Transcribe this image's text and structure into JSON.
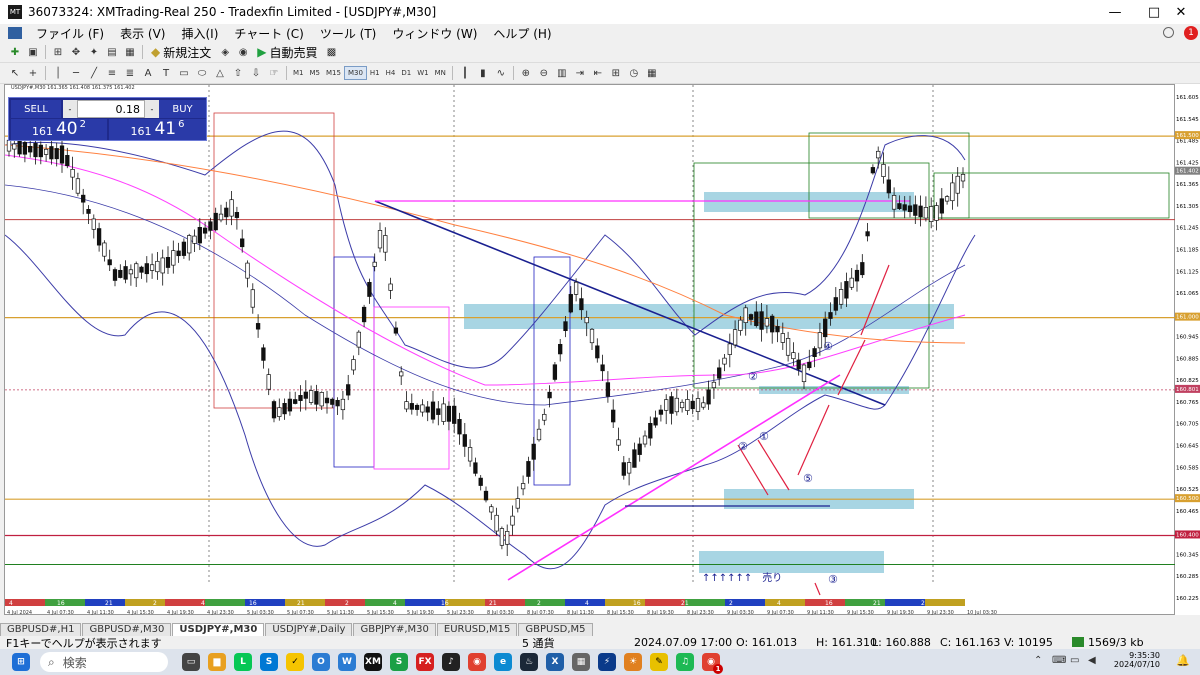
{
  "window": {
    "title": "36073324: XMTrading-Real 250 - Tradexfin Limited - [USDJPY#,M30]",
    "app_icon": "MT",
    "minimize": "—",
    "maximize": "□",
    "close": "✕"
  },
  "menu": [
    "ファイル (F)",
    "表示 (V)",
    "挿入(I)",
    "チャート (C)",
    "ツール (T)",
    "ウィンドウ (W)",
    "ヘルプ (H)"
  ],
  "toolbar": {
    "new_order": "新規注文",
    "auto_trade": "自動売買",
    "timeframes": [
      "M1",
      "M5",
      "M15",
      "M30",
      "H1",
      "H4",
      "D1",
      "W1",
      "MN"
    ],
    "active_timeframe": "M30",
    "notification_count": "1"
  },
  "trade_panel": {
    "sell_label": "SELL",
    "buy_label": "BUY",
    "volume": "0.18",
    "sell_price_main": "161",
    "sell_price_big": "40",
    "sell_price_sup": "2",
    "buy_price_main": "161",
    "buy_price_big": "41",
    "buy_price_sup": "6"
  },
  "chart_info": "USDJPY#,M30 161.365 161.408 161.375 161.402",
  "price_axis": [
    "161.605",
    "161.545",
    "161.485",
    "161.425",
    "161.365",
    "161.305",
    "161.245",
    "161.185",
    "161.125",
    "161.065",
    "161.005",
    "160.945",
    "160.885",
    "160.825",
    "160.765",
    "160.705",
    "160.645",
    "160.585",
    "160.525",
    "160.465",
    "160.405",
    "160.345",
    "160.285",
    "160.225"
  ],
  "price_tags": [
    {
      "label": "161.500",
      "color": "#d8a030"
    },
    {
      "label": "161.402",
      "color": "#808080"
    },
    {
      "label": "161.000",
      "color": "#d8a030"
    },
    {
      "label": "160.801",
      "color": "#c04060"
    },
    {
      "label": "160.500",
      "color": "#d8a030"
    },
    {
      "label": "160.400",
      "color": "#c02040"
    }
  ],
  "time_axis": [
    "4 Jul 2024",
    "4 Jul 07:30",
    "4 Jul 11:30",
    "4 Jul 15:30",
    "4 Jul 19:30",
    "4 Jul 23:30",
    "5 Jul 03:30",
    "5 Jul 07:30",
    "5 Jul 11:30",
    "5 Jul 15:30",
    "5 Jul 19:30",
    "5 Jul 23:30",
    "8 Jul 03:30",
    "8 Jul 07:30",
    "8 Jul 11:30",
    "8 Jul 15:30",
    "8 Jul 19:30",
    "8 Jul 23:30",
    "9 Jul 03:30",
    "9 Jul 07:30",
    "9 Jul 11:30",
    "9 Jul 15:30",
    "9 Jul 19:30",
    "9 Jul 23:30",
    "10 Jul 03:30"
  ],
  "strip_labels": [
    "4",
    "16",
    "21",
    "2",
    "4",
    "16",
    "21",
    "2",
    "4",
    "16",
    "21",
    "2",
    "4",
    "16",
    "21",
    "2",
    "4",
    "16",
    "21",
    "2",
    "4"
  ],
  "annotations": {
    "circle1": "①",
    "circle2a": "②",
    "circle2b": "②",
    "circle3": "③",
    "circle4": "④",
    "circle5": "⑤",
    "sell_note": "↑↑↑↑↑↑　売り"
  },
  "tabs": [
    "GBPUSD#,H1",
    "GBPUSD#,M30",
    "USDJPY#,M30",
    "USDJPY#,Daily",
    "GBPJPY#,M30",
    "EURUSD,M15",
    "GBPUSD,M5"
  ],
  "active_tab": "USDJPY#,M30",
  "status": {
    "help": "F1キーでヘルプが表示されます",
    "profile": "5 通貨",
    "datetime": "2024.07.09 17:00",
    "open": "O: 161.013",
    "high": "H: 161.310",
    "low": "L: 160.888",
    "close": "C: 161.163",
    "volume": "V: 10195",
    "traffic": "1569/3 kb"
  },
  "taskbar": {
    "search_placeholder": "検索",
    "time": "9:35:30",
    "date": "2024/07/10",
    "badge": "1"
  },
  "colors": {
    "bull": "#1a1a1a",
    "bear": "#1a1a1a",
    "bollinger": "#3c3ca8",
    "ma_short": "#ff40ff",
    "ma_long": "#ff8040",
    "zone": "#9fd0e0",
    "resistance": "#d8a030",
    "support_red": "#c02040",
    "trend_down": "#1a2090",
    "trend_up": "#ff30ff"
  }
}
